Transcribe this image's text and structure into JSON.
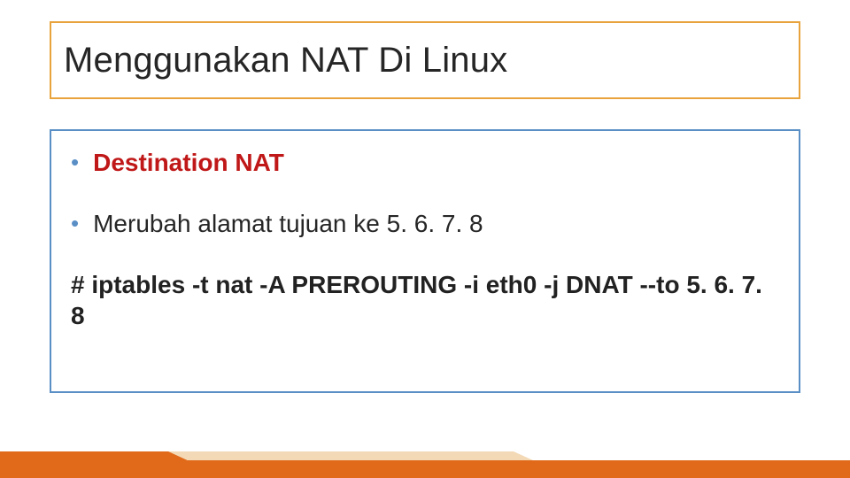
{
  "title": "Menggunakan NAT Di Linux",
  "bullets": [
    {
      "text": "Destination NAT",
      "style": "red-bold"
    },
    {
      "text": "Merubah alamat tujuan ke 5. 6. 7. 8",
      "style": ""
    }
  ],
  "command": "# iptables -t nat -A PREROUTING -i eth0 -j DNAT --to 5. 6. 7. 8",
  "colors": {
    "title_border": "#e8a33d",
    "content_border": "#5a8fc6",
    "accent_red": "#c01818",
    "footer_orange": "#e06a1a",
    "footer_light": "#f3d9b6"
  }
}
